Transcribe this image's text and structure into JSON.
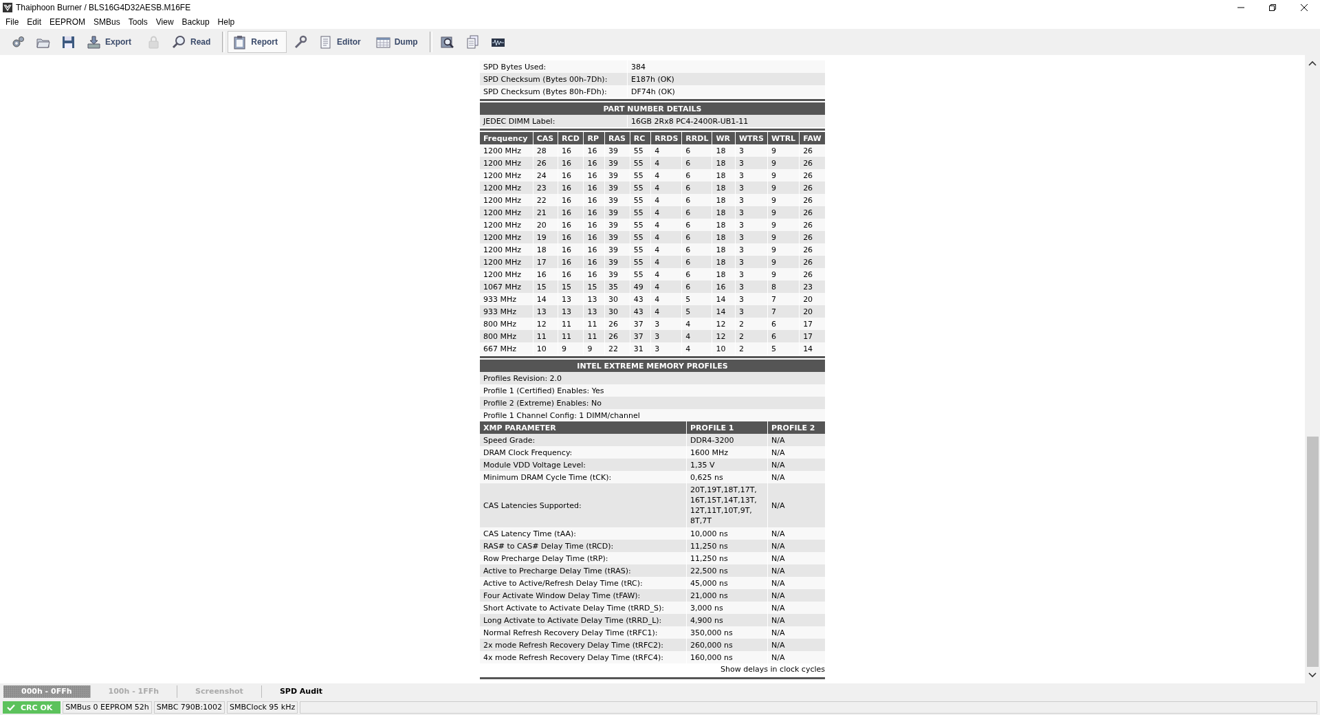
{
  "window": {
    "title": "Thaiphoon Burner / BLS16G4D32AESB.M16FE"
  },
  "menu": [
    "File",
    "Edit",
    "EEPROM",
    "SMBus",
    "Tools",
    "View",
    "Backup",
    "Help"
  ],
  "toolbar": [
    [
      {
        "selected": false,
        "disabled": false
      },
      {
        "selected": false,
        "disabled": false
      },
      {
        "selected": false,
        "disabled": false
      },
      {
        "label": "Export",
        "selected": false,
        "disabled": false
      },
      {
        "selected": false,
        "disabled": true
      },
      {
        "label": "Read",
        "selected": false,
        "disabled": false
      }
    ],
    [
      {
        "label": "Report",
        "selected": true,
        "disabled": false
      },
      {
        "selected": false,
        "disabled": false
      },
      {
        "label": "Editor",
        "selected": false,
        "disabled": false
      },
      {
        "label": "Dump",
        "selected": false,
        "disabled": false
      }
    ],
    [
      {
        "selected": false,
        "disabled": false
      },
      {
        "selected": false,
        "disabled": false
      },
      {
        "selected": false,
        "disabled": false
      }
    ]
  ],
  "report": {
    "info": [
      {
        "label": "SPD Bytes Used:",
        "value": "384"
      },
      {
        "label": "SPD Checksum (Bytes 00h-7Dh):",
        "value": "E187h (OK)"
      },
      {
        "label": "SPD Checksum (Bytes 80h-FDh):",
        "value": "DF74h (OK)"
      }
    ],
    "part_number": {
      "title": "PART NUMBER DETAILS",
      "rows": [
        {
          "label": "JEDEC DIMM Label:",
          "value": "16GB 2Rx8 PC4-2400R-UB1-11"
        }
      ]
    },
    "timings": {
      "columns": [
        "Frequency",
        "CAS",
        "RCD",
        "RP",
        "RAS",
        "RC",
        "RRDS",
        "RRDL",
        "WR",
        "WTRS",
        "WTRL",
        "FAW"
      ],
      "rows": [
        [
          "1200 MHz",
          "28",
          "16",
          "16",
          "39",
          "55",
          "4",
          "6",
          "18",
          "3",
          "9",
          "26"
        ],
        [
          "1200 MHz",
          "26",
          "16",
          "16",
          "39",
          "55",
          "4",
          "6",
          "18",
          "3",
          "9",
          "26"
        ],
        [
          "1200 MHz",
          "24",
          "16",
          "16",
          "39",
          "55",
          "4",
          "6",
          "18",
          "3",
          "9",
          "26"
        ],
        [
          "1200 MHz",
          "23",
          "16",
          "16",
          "39",
          "55",
          "4",
          "6",
          "18",
          "3",
          "9",
          "26"
        ],
        [
          "1200 MHz",
          "22",
          "16",
          "16",
          "39",
          "55",
          "4",
          "6",
          "18",
          "3",
          "9",
          "26"
        ],
        [
          "1200 MHz",
          "21",
          "16",
          "16",
          "39",
          "55",
          "4",
          "6",
          "18",
          "3",
          "9",
          "26"
        ],
        [
          "1200 MHz",
          "20",
          "16",
          "16",
          "39",
          "55",
          "4",
          "6",
          "18",
          "3",
          "9",
          "26"
        ],
        [
          "1200 MHz",
          "19",
          "16",
          "16",
          "39",
          "55",
          "4",
          "6",
          "18",
          "3",
          "9",
          "26"
        ],
        [
          "1200 MHz",
          "18",
          "16",
          "16",
          "39",
          "55",
          "4",
          "6",
          "18",
          "3",
          "9",
          "26"
        ],
        [
          "1200 MHz",
          "17",
          "16",
          "16",
          "39",
          "55",
          "4",
          "6",
          "18",
          "3",
          "9",
          "26"
        ],
        [
          "1200 MHz",
          "16",
          "16",
          "16",
          "39",
          "55",
          "4",
          "6",
          "18",
          "3",
          "9",
          "26"
        ],
        [
          "1067 MHz",
          "15",
          "15",
          "15",
          "35",
          "49",
          "4",
          "6",
          "16",
          "3",
          "8",
          "23"
        ],
        [
          "933 MHz",
          "14",
          "13",
          "13",
          "30",
          "43",
          "4",
          "5",
          "14",
          "3",
          "7",
          "20"
        ],
        [
          "933 MHz",
          "13",
          "13",
          "13",
          "30",
          "43",
          "4",
          "5",
          "14",
          "3",
          "7",
          "20"
        ],
        [
          "800 MHz",
          "12",
          "11",
          "11",
          "26",
          "37",
          "3",
          "4",
          "12",
          "2",
          "6",
          "17"
        ],
        [
          "800 MHz",
          "11",
          "11",
          "11",
          "26",
          "37",
          "3",
          "4",
          "12",
          "2",
          "6",
          "17"
        ],
        [
          "667 MHz",
          "10",
          "9",
          "9",
          "22",
          "31",
          "3",
          "4",
          "10",
          "2",
          "5",
          "14"
        ]
      ]
    },
    "xmp": {
      "title": "INTEL EXTREME MEMORY PROFILES",
      "lines": [
        "Profiles Revision: 2.0",
        "Profile 1 (Certified) Enables: Yes",
        "Profile 2 (Extreme) Enables: No",
        "Profile 1 Channel Config: 1 DIMM/channel"
      ],
      "columns": [
        "XMP PARAMETER",
        "PROFILE 1",
        "PROFILE 2"
      ],
      "rows": [
        {
          "parameter": "Speed Grade:",
          "profile_1": "DDR4-3200",
          "profile_2": "N/A"
        },
        {
          "parameter": "DRAM Clock Frequency:",
          "profile_1": "1600 MHz",
          "profile_2": "N/A"
        },
        {
          "parameter": "Module VDD Voltage Level:",
          "profile_1": "1,35 V",
          "profile_2": "N/A"
        },
        {
          "parameter": "Minimum DRAM Cycle Time (tCK):",
          "profile_1": "0,625 ns",
          "profile_2": "N/A"
        },
        {
          "parameter": "CAS Latencies Supported:",
          "profile_1": "20T,19T,18T,17T,16T,15T,14T,13T,12T,11T,10T,9T,8T,7T",
          "profile_2": "N/A"
        },
        {
          "parameter": "CAS Latency Time (tAA):",
          "profile_1": "10,000 ns",
          "profile_2": "N/A"
        },
        {
          "parameter": "RAS# to CAS# Delay Time (tRCD):",
          "profile_1": "11,250 ns",
          "profile_2": "N/A"
        },
        {
          "parameter": "Row Precharge Delay Time (tRP):",
          "profile_1": "11,250 ns",
          "profile_2": "N/A"
        },
        {
          "parameter": "Active to Precharge Delay Time (tRAS):",
          "profile_1": "22,500 ns",
          "profile_2": "N/A"
        },
        {
          "parameter": "Active to Active/Refresh Delay Time (tRC):",
          "profile_1": "45,000 ns",
          "profile_2": "N/A"
        },
        {
          "parameter": "Four Activate Window Delay Time (tFAW):",
          "profile_1": "21,000 ns",
          "profile_2": "N/A"
        },
        {
          "parameter": "Short Activate to Activate Delay Time (tRRD_S):",
          "profile_1": "3,000 ns",
          "profile_2": "N/A"
        },
        {
          "parameter": "Long Activate to Activate Delay Time (tRRD_L):",
          "profile_1": "4,900 ns",
          "profile_2": "N/A"
        },
        {
          "parameter": "Normal Refresh Recovery Delay Time (tRFC1):",
          "profile_1": "350,000 ns",
          "profile_2": "N/A"
        },
        {
          "parameter": "2x mode Refresh Recovery Delay Time (tRFC2):",
          "profile_1": "260,000 ns",
          "profile_2": "N/A"
        },
        {
          "parameter": "4x mode Refresh Recovery Delay Time (tRFC4):",
          "profile_1": "160,000 ns",
          "profile_2": "N/A"
        }
      ]
    },
    "footer_link": "Show delays in clock cycles"
  },
  "bottom_tabs": [
    {
      "label": "000h - 0FFh",
      "selected": false,
      "disabled": true
    },
    {
      "label": "100h - 1FFh",
      "selected": false,
      "disabled": false
    },
    {
      "label": "Screenshot",
      "selected": false,
      "disabled": false
    },
    {
      "label": "SPD Audit",
      "selected": true,
      "disabled": false
    }
  ],
  "status_bar": {
    "crc": {
      "text": "CRC OK",
      "ok": true
    },
    "fields": [
      "SMBus 0 EEPROM 52h",
      "SMBC 790B:1002",
      "SMBClock 95 kHz"
    ]
  }
}
